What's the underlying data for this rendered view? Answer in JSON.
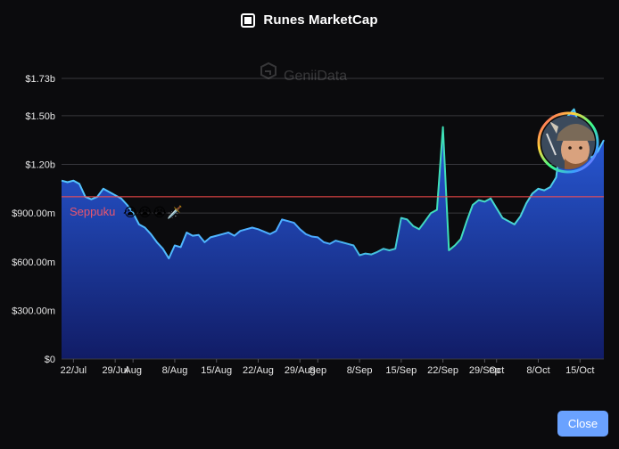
{
  "header": {
    "title": "Runes MarketCap",
    "icon": "square-logo-icon"
  },
  "watermark": {
    "text": "GeniiData",
    "icon": "geniidata-logo-icon"
  },
  "annotation": {
    "text": "Seppuku",
    "emoji": "😭😭😭🗡️",
    "color": "#e8566e"
  },
  "avatar": {
    "icon": "avatar-viking-icon"
  },
  "close_button": {
    "label": "Close"
  },
  "colors": {
    "background": "#0b0b0d",
    "area_top": "#2a5fe0",
    "area_bottom": "#111c66",
    "line": "#55c6ff",
    "spike": "#3ee0b5",
    "threshold": "#ff4d4d",
    "grid": "#2c2c30",
    "button": "#6aa2ff"
  },
  "chart_data": {
    "type": "area",
    "title": "Runes MarketCap",
    "xlabel": "",
    "ylabel": "",
    "ylim": [
      0,
      1730000000
    ],
    "x_range": [
      "2024-07-20",
      "2024-10-19"
    ],
    "y_ticks": [
      {
        "value": 0,
        "label": "$0"
      },
      {
        "value": 300000000,
        "label": "$300.00m"
      },
      {
        "value": 600000000,
        "label": "$600.00m"
      },
      {
        "value": 900000000,
        "label": "$900.00m"
      },
      {
        "value": 1200000000,
        "label": "$1.20b"
      },
      {
        "value": 1500000000,
        "label": "$1.50b"
      },
      {
        "value": 1730000000,
        "label": "$1.73b"
      }
    ],
    "x_ticks": [
      {
        "date": "2024-07-22",
        "label": "22/Jul"
      },
      {
        "date": "2024-07-29",
        "label": "29/Jul"
      },
      {
        "date": "2024-08-01",
        "label": "Aug"
      },
      {
        "date": "2024-08-08",
        "label": "8/Aug"
      },
      {
        "date": "2024-08-15",
        "label": "15/Aug"
      },
      {
        "date": "2024-08-22",
        "label": "22/Aug"
      },
      {
        "date": "2024-08-29",
        "label": "29/Aug"
      },
      {
        "date": "2024-09-01",
        "label": "Sep"
      },
      {
        "date": "2024-09-08",
        "label": "8/Sep"
      },
      {
        "date": "2024-09-15",
        "label": "15/Sep"
      },
      {
        "date": "2024-09-22",
        "label": "22/Sep"
      },
      {
        "date": "2024-09-29",
        "label": "29/Sep"
      },
      {
        "date": "2024-10-01",
        "label": "Oct"
      },
      {
        "date": "2024-10-08",
        "label": "8/Oct"
      },
      {
        "date": "2024-10-15",
        "label": "15/Oct"
      }
    ],
    "reference_line": {
      "value": 1000000000
    },
    "grid": true,
    "legend": "none",
    "series": [
      {
        "points": [
          [
            "2024-07-20",
            1100000000
          ],
          [
            "2024-07-21",
            1090000000
          ],
          [
            "2024-07-22",
            1100000000
          ],
          [
            "2024-07-23",
            1080000000
          ],
          [
            "2024-07-24",
            1000000000
          ],
          [
            "2024-07-25",
            985000000
          ],
          [
            "2024-07-26",
            1000000000
          ],
          [
            "2024-07-27",
            1050000000
          ],
          [
            "2024-07-28",
            1030000000
          ],
          [
            "2024-07-29",
            1010000000
          ],
          [
            "2024-07-30",
            990000000
          ],
          [
            "2024-07-31",
            950000000
          ],
          [
            "2024-08-01",
            900000000
          ],
          [
            "2024-08-02",
            830000000
          ],
          [
            "2024-08-03",
            810000000
          ],
          [
            "2024-08-04",
            770000000
          ],
          [
            "2024-08-05",
            720000000
          ],
          [
            "2024-08-06",
            680000000
          ],
          [
            "2024-08-07",
            620000000
          ],
          [
            "2024-08-08",
            700000000
          ],
          [
            "2024-08-09",
            690000000
          ],
          [
            "2024-08-10",
            780000000
          ],
          [
            "2024-08-11",
            760000000
          ],
          [
            "2024-08-12",
            765000000
          ],
          [
            "2024-08-13",
            720000000
          ],
          [
            "2024-08-14",
            750000000
          ],
          [
            "2024-08-15",
            760000000
          ],
          [
            "2024-08-16",
            770000000
          ],
          [
            "2024-08-17",
            780000000
          ],
          [
            "2024-08-18",
            760000000
          ],
          [
            "2024-08-19",
            790000000
          ],
          [
            "2024-08-20",
            800000000
          ],
          [
            "2024-08-21",
            810000000
          ],
          [
            "2024-08-22",
            800000000
          ],
          [
            "2024-08-23",
            785000000
          ],
          [
            "2024-08-24",
            770000000
          ],
          [
            "2024-08-25",
            790000000
          ],
          [
            "2024-08-26",
            860000000
          ],
          [
            "2024-08-27",
            850000000
          ],
          [
            "2024-08-28",
            840000000
          ],
          [
            "2024-08-29",
            800000000
          ],
          [
            "2024-08-30",
            770000000
          ],
          [
            "2024-08-31",
            755000000
          ],
          [
            "2024-09-01",
            750000000
          ],
          [
            "2024-09-02",
            720000000
          ],
          [
            "2024-09-03",
            710000000
          ],
          [
            "2024-09-04",
            730000000
          ],
          [
            "2024-09-05",
            720000000
          ],
          [
            "2024-09-06",
            710000000
          ],
          [
            "2024-09-07",
            700000000
          ],
          [
            "2024-09-08",
            640000000
          ],
          [
            "2024-09-09",
            650000000
          ],
          [
            "2024-09-10",
            645000000
          ],
          [
            "2024-09-11",
            660000000
          ],
          [
            "2024-09-12",
            680000000
          ],
          [
            "2024-09-13",
            670000000
          ],
          [
            "2024-09-14",
            680000000
          ],
          [
            "2024-09-15",
            870000000
          ],
          [
            "2024-09-16",
            860000000
          ],
          [
            "2024-09-17",
            820000000
          ],
          [
            "2024-09-18",
            800000000
          ],
          [
            "2024-09-19",
            850000000
          ],
          [
            "2024-09-20",
            900000000
          ],
          [
            "2024-09-21",
            920000000
          ],
          [
            "2024-09-22",
            1430000000
          ],
          [
            "2024-09-23",
            670000000
          ],
          [
            "2024-09-24",
            700000000
          ],
          [
            "2024-09-25",
            740000000
          ],
          [
            "2024-09-26",
            850000000
          ],
          [
            "2024-09-27",
            950000000
          ],
          [
            "2024-09-28",
            980000000
          ],
          [
            "2024-09-29",
            970000000
          ],
          [
            "2024-09-30",
            990000000
          ],
          [
            "2024-10-01",
            930000000
          ],
          [
            "2024-10-02",
            870000000
          ],
          [
            "2024-10-03",
            850000000
          ],
          [
            "2024-10-04",
            830000000
          ],
          [
            "2024-10-05",
            880000000
          ],
          [
            "2024-10-06",
            960000000
          ],
          [
            "2024-10-07",
            1020000000
          ],
          [
            "2024-10-08",
            1050000000
          ],
          [
            "2024-10-09",
            1040000000
          ],
          [
            "2024-10-10",
            1060000000
          ],
          [
            "2024-10-11",
            1120000000
          ],
          [
            "2024-10-12",
            1400000000
          ],
          [
            "2024-10-13",
            1500000000
          ],
          [
            "2024-10-14",
            1540000000
          ],
          [
            "2024-10-15",
            1420000000
          ],
          [
            "2024-10-16",
            1300000000
          ],
          [
            "2024-10-17",
            1240000000
          ],
          [
            "2024-10-18",
            1280000000
          ],
          [
            "2024-10-19",
            1350000000
          ]
        ]
      }
    ]
  }
}
